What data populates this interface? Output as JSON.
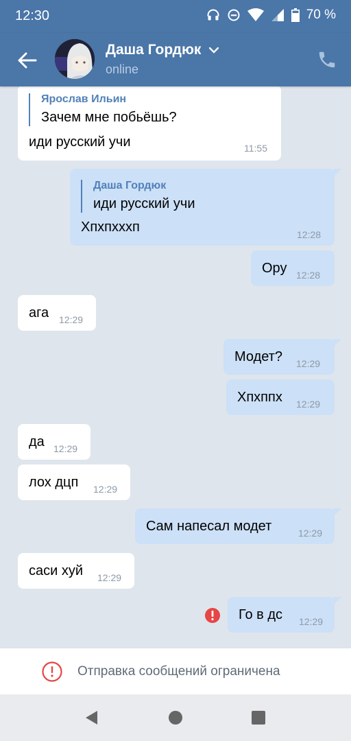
{
  "status_bar": {
    "time": "12:30",
    "battery": "70 %",
    "icons": [
      "headphones-icon",
      "dnd-icon",
      "wifi-icon",
      "signal-icon",
      "battery-icon"
    ]
  },
  "header": {
    "name": "Даша Гордюк",
    "status": "online",
    "icons": [
      "back-arrow-icon",
      "chevron-down-icon",
      "phone-icon"
    ]
  },
  "messages": [
    {
      "dir": "in",
      "quote_author": "Ярослав Ильин",
      "quote_text": "Зачем мне побьёшь?",
      "text": "иди русский учи",
      "time": "11:55"
    },
    {
      "dir": "out",
      "quote_author": "Даша Гордюк",
      "quote_text": "иди русский учи",
      "text": "Хпхпхххп",
      "time": "12:28"
    },
    {
      "dir": "out",
      "text": "Ору",
      "time": "12:28"
    },
    {
      "dir": "in",
      "text": "ага",
      "time": "12:29"
    },
    {
      "dir": "out",
      "text": "Модет?",
      "time": "12:29"
    },
    {
      "dir": "out",
      "text": "Хпхппх",
      "time": "12:29"
    },
    {
      "dir": "in",
      "text": "да",
      "time": "12:29"
    },
    {
      "dir": "in",
      "text": "лох дцп",
      "time": "12:29"
    },
    {
      "dir": "out",
      "text": "Сам напесал модет",
      "time": "12:29"
    },
    {
      "dir": "in",
      "text": "саси хуй",
      "time": "12:29"
    },
    {
      "dir": "out",
      "text": "Го в дс",
      "time": "12:29",
      "failed": true
    }
  ],
  "footer": {
    "restriction_text": "Отправка сообщений ограничена"
  },
  "colors": {
    "header_bg": "#4a76a8",
    "incoming_bubble": "#ffffff",
    "outgoing_bubble": "#cce0f7",
    "chat_bg": "#dfe5ec",
    "error": "#e64646"
  }
}
